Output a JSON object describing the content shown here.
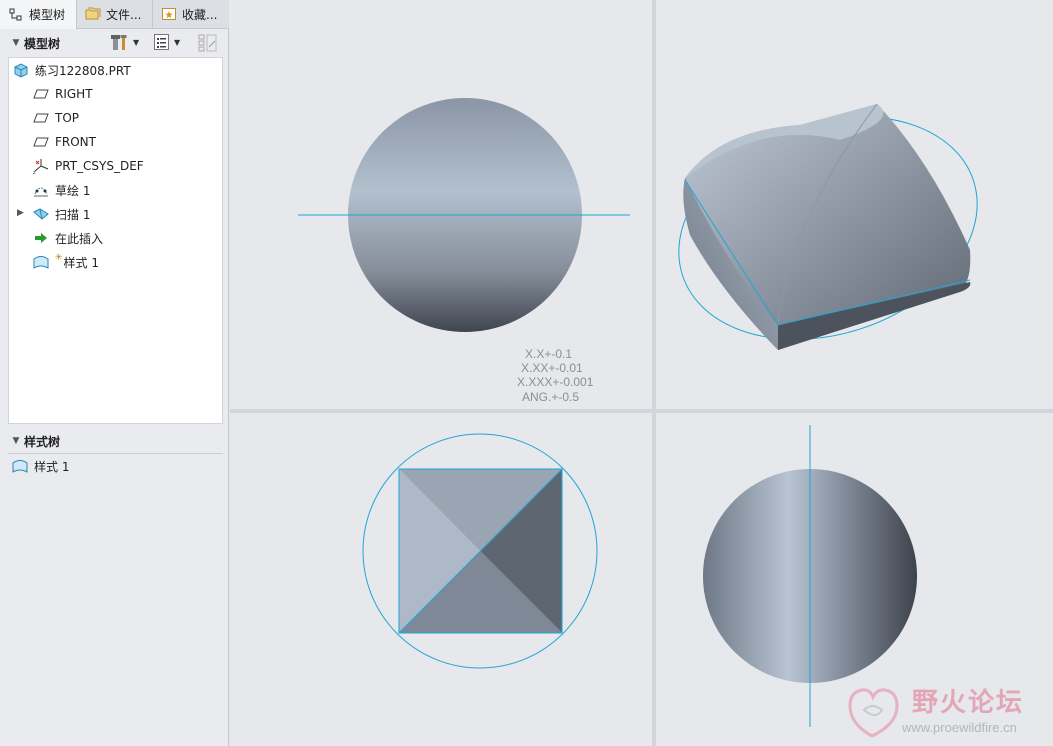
{
  "tabs": [
    {
      "label": "模型树",
      "icon": "model-tree-icon"
    },
    {
      "label": "文件...",
      "icon": "folder-icon"
    },
    {
      "label": "收藏...",
      "icon": "favorites-icon"
    }
  ],
  "model_tree": {
    "header": "模型树",
    "items": [
      {
        "label": "练习122808.PRT",
        "icon": "part-icon"
      },
      {
        "label": "RIGHT",
        "icon": "datum-plane-icon"
      },
      {
        "label": "TOP",
        "icon": "datum-plane-icon"
      },
      {
        "label": "FRONT",
        "icon": "datum-plane-icon"
      },
      {
        "label": "PRT_CSYS_DEF",
        "icon": "csys-icon"
      },
      {
        "label": "草绘 1",
        "icon": "sketch-icon"
      },
      {
        "label": "扫描 1",
        "icon": "sweep-icon"
      },
      {
        "label": "在此插入",
        "icon": "insert-here-arrow-icon"
      },
      {
        "label": "样式 1",
        "icon": "style-icon"
      }
    ]
  },
  "style_tree": {
    "header": "样式树",
    "items": [
      {
        "label": "样式 1",
        "icon": "style-icon"
      }
    ]
  },
  "tolerances": [
    "X.X+-0.1",
    "X.XX+-0.01",
    "X.XXX+-0.001",
    "ANG.+-0.5"
  ],
  "watermark": {
    "title": "野火论坛",
    "url": "www.proewildfire.cn"
  },
  "colors": {
    "datum_line": "#1fa6d6",
    "model_dark": "#5d6470",
    "model_light": "#aebac9",
    "background": "#e6e8eb"
  }
}
